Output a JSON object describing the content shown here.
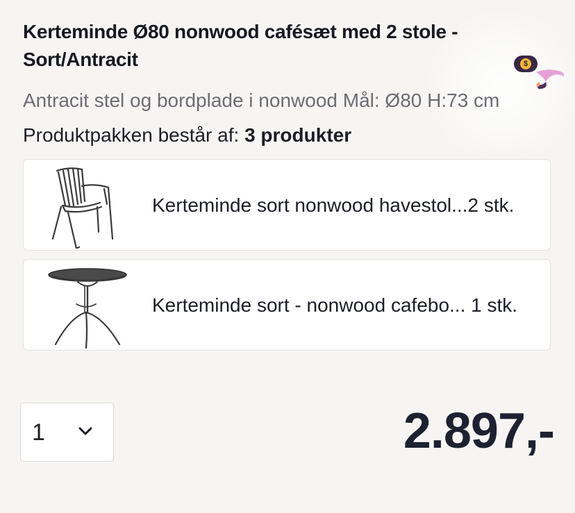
{
  "product": {
    "title": "Kerteminde Ø80 nonwood cafésæt med 2 stole - Sort/Antracit",
    "description": "Antracit stel og bordplade i nonwood Mål: Ø80 H:73 cm",
    "package_label": "Produktpakken består af:",
    "package_count": "3 produkter"
  },
  "badge": {
    "icon": "money-bag-icon",
    "symbol": "$",
    "color": "#3a2748",
    "coin_color": "#f0b730"
  },
  "package_items": [
    {
      "image": "garden-chair-image",
      "text": "Kerteminde sort nonwood havestol...2 stk."
    },
    {
      "image": "cafe-table-image",
      "text": "Kerteminde sort - nonwood cafebo... 1 stk."
    }
  ],
  "quantity": {
    "value": "1",
    "icon": "chevron-down-icon"
  },
  "price": {
    "text": "2.897,-",
    "color": "#1d2130"
  }
}
